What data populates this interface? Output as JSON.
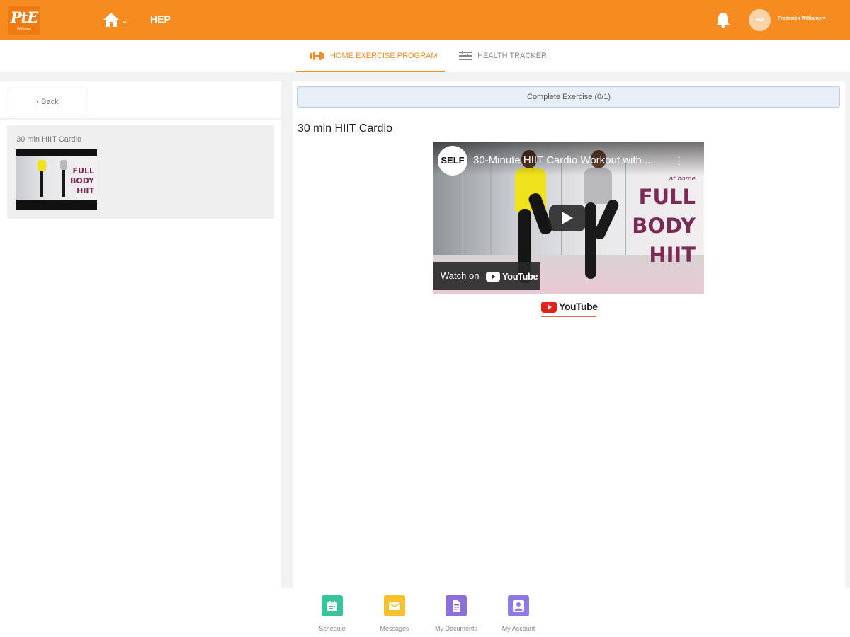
{
  "header": {
    "logo_mark": "PtE",
    "logo_sub": "Wellness",
    "nav_link": "HEP",
    "avatar_initials": "FW",
    "user_name": "Frederick Williams ▾",
    "brand_color": "#f68b1f"
  },
  "tabs": [
    {
      "label": "HOME EXERCISE PROGRAM",
      "icon": "dumbbell-icon",
      "active": true
    },
    {
      "label": "HEALTH TRACKER",
      "icon": "tracker-icon",
      "active": false
    }
  ],
  "sidebar": {
    "back_label": "‹ Back",
    "exercise": {
      "title": "30 min HIIT Cardio",
      "thumb_text": [
        "FULL",
        "BODY",
        "HIIT"
      ]
    }
  },
  "main": {
    "complete_label": "Complete Exercise (0/1)",
    "exercise_title": "30 min HIIT Cardio",
    "video": {
      "channel": "SELF",
      "title": "30-Minute HIIT Cardio Workout with ...",
      "overlay_small": "at home",
      "overlay_lines": [
        "FULL",
        "BODY",
        "HIIT"
      ],
      "watch_on": "Watch on",
      "watch_on_brand": "YouTube"
    },
    "youtube_link": "YouTube"
  },
  "bottom_nav": [
    {
      "label": "Schedule",
      "icon": "calendar-icon",
      "color": "#39c49e"
    },
    {
      "label": "Messages",
      "icon": "envelope-icon",
      "color": "#f6c12b"
    },
    {
      "label": "My Documents",
      "icon": "document-icon",
      "color": "#8c6fdc"
    },
    {
      "label": "My Account",
      "icon": "person-icon",
      "color": "#8f79e4"
    }
  ]
}
